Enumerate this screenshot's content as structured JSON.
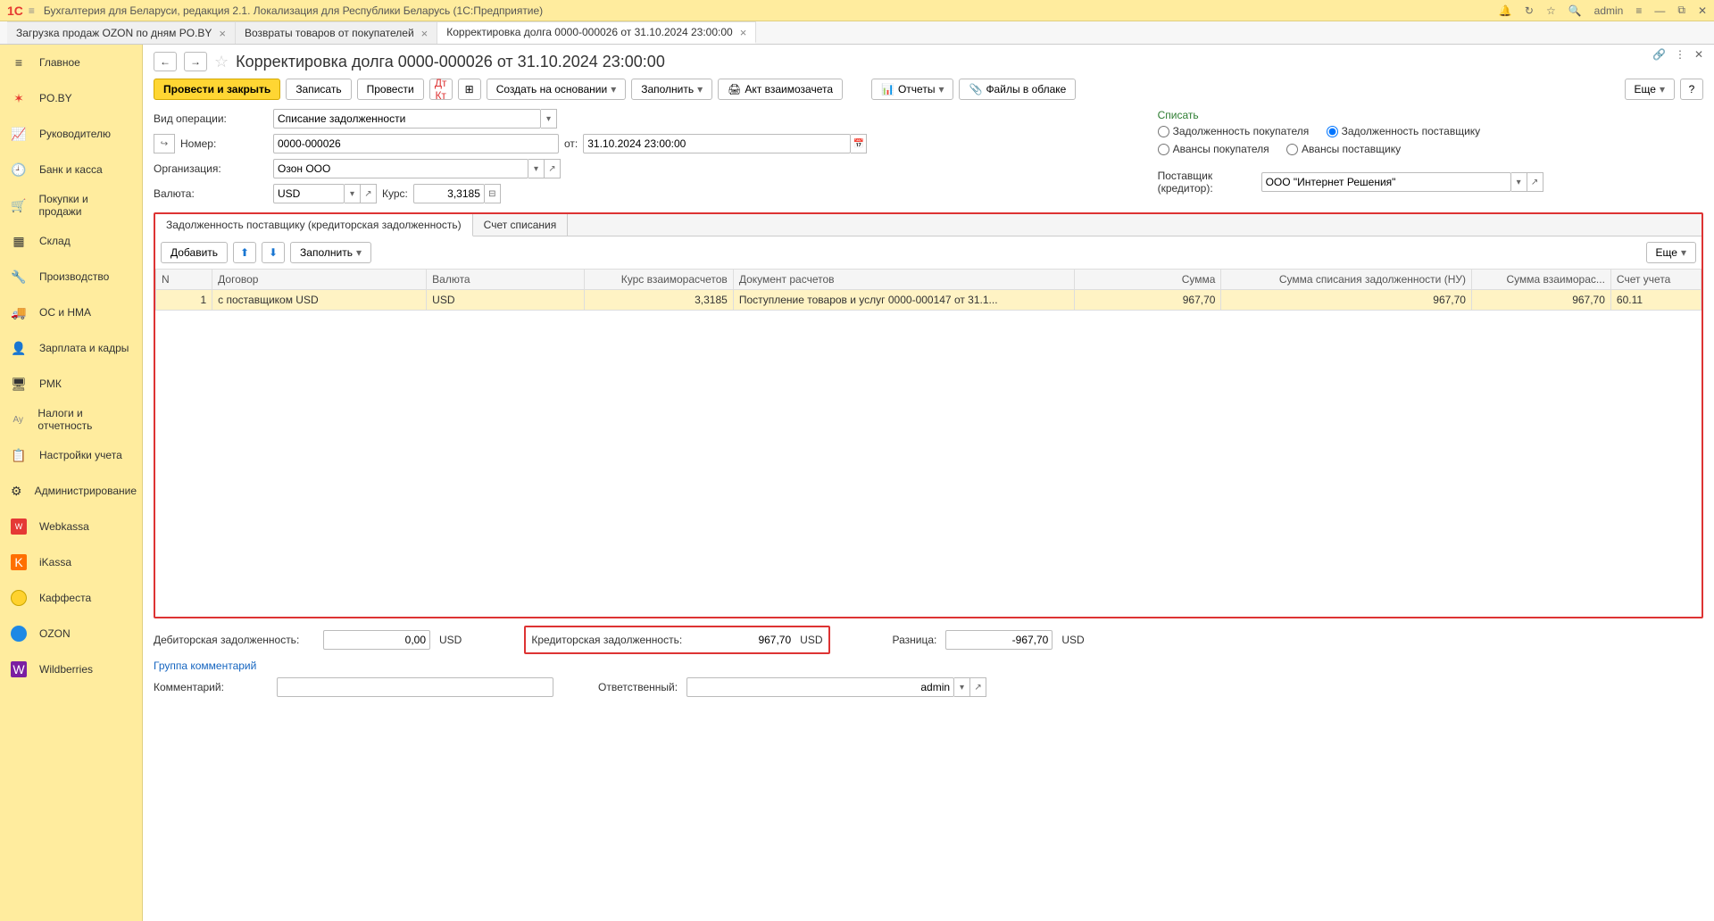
{
  "titlebar": {
    "app_title": "Бухгалтерия для Беларуси, редакция 2.1. Локализация для Республики Беларусь  (1С:Предприятие)",
    "user": "admin"
  },
  "tabs": [
    {
      "label": "Загрузка продаж OZON по дням PO.BY"
    },
    {
      "label": "Возвраты товаров от покупателей"
    },
    {
      "label": "Корректировка долга 0000-000026 от 31.10.2024 23:00:00",
      "active": true
    }
  ],
  "sidebar": {
    "items": [
      {
        "label": "Главное",
        "icon": "≡"
      },
      {
        "label": "PO.BY",
        "icon": "★"
      },
      {
        "label": "Руководителю",
        "icon": "📈"
      },
      {
        "label": "Банк и касса",
        "icon": "🕘"
      },
      {
        "label": "Покупки и продажи",
        "icon": "🛒"
      },
      {
        "label": "Склад",
        "icon": "▦"
      },
      {
        "label": "Производство",
        "icon": "⚙"
      },
      {
        "label": "ОС и НМА",
        "icon": "🚚"
      },
      {
        "label": "Зарплата и кадры",
        "icon": "👤"
      },
      {
        "label": "РМК",
        "icon": "🖥"
      },
      {
        "label": "Налоги и отчетность",
        "icon": "Ay"
      },
      {
        "label": "Настройки учета",
        "icon": "📋"
      },
      {
        "label": "Администрирование",
        "icon": "⚙"
      },
      {
        "label": "Webkassa",
        "icon": "W",
        "iconClass": "sq-red"
      },
      {
        "label": "iKassa",
        "icon": "K",
        "iconClass": "sq-orange"
      },
      {
        "label": "Каффеста",
        "icon": "",
        "iconClass": "dot-yellow"
      },
      {
        "label": "OZON",
        "icon": "",
        "iconClass": "dot-blue"
      },
      {
        "label": "Wildberries",
        "icon": "W",
        "iconClass": "sq-purple"
      }
    ]
  },
  "doc": {
    "title": "Корректировка долга 0000-000026 от 31.10.2024 23:00:00",
    "toolbar": {
      "post_close": "Провести и закрыть",
      "save": "Записать",
      "post": "Провести",
      "create_based": "Создать на основании",
      "fill": "Заполнить",
      "act": "Акт взаимозачета",
      "reports": "Отчеты",
      "cloud_files": "Файлы в облаке",
      "more": "Еще",
      "help": "?"
    },
    "fields": {
      "operation_label": "Вид операции:",
      "operation_value": "Списание задолженности",
      "number_label": "Номер:",
      "number_value": "0000-000026",
      "from_label": "от:",
      "date_value": "31.10.2024 23:00:00",
      "org_label": "Организация:",
      "org_value": "Озон ООО",
      "currency_label": "Валюта:",
      "currency_value": "USD",
      "rate_label": "Курс:",
      "rate_value": "3,3185"
    },
    "writeoff": {
      "title": "Списать",
      "opt1": "Задолженность покупателя",
      "opt2": "Задолженность поставщику",
      "opt3": "Авансы покупателя",
      "opt4": "Авансы поставщику",
      "supplier_label": "Поставщик (кредитор):",
      "supplier_value": "ООО \"Интернет Решения\""
    },
    "inner_tabs": {
      "tab1": "Задолженность поставщику (кредиторская задолженность)",
      "tab2": "Счет списания"
    },
    "grid_toolbar": {
      "add": "Добавить",
      "fill": "Заполнить",
      "more": "Еще"
    },
    "grid": {
      "cols": {
        "n": "N",
        "contract": "Договор",
        "currency": "Валюта",
        "rate": "Курс взаиморасчетов",
        "doc": "Документ расчетов",
        "sum": "Сумма",
        "sum_nu": "Сумма списания задолженности (НУ)",
        "sum_vz": "Сумма взаиморас...",
        "account": "Счет учета"
      },
      "rows": [
        {
          "n": "1",
          "contract": "с поставщиком USD",
          "currency": "USD",
          "rate": "3,3185",
          "doc": "Поступление товаров и услуг 0000-000147 от 31.1...",
          "sum": "967,70",
          "sum_nu": "967,70",
          "sum_vz": "967,70",
          "account": "60.11"
        }
      ]
    },
    "footer": {
      "debit_label": "Дебиторская задолженность:",
      "debit_value": "0,00",
      "debit_cur": "USD",
      "credit_label": "Кредиторская задолженность:",
      "credit_value": "967,70",
      "credit_cur": "USD",
      "diff_label": "Разница:",
      "diff_value": "-967,70",
      "diff_cur": "USD",
      "group_comments": "Группа комментарий",
      "comment_label": "Комментарий:",
      "responsible_label": "Ответственный:",
      "responsible_value": "admin"
    }
  }
}
